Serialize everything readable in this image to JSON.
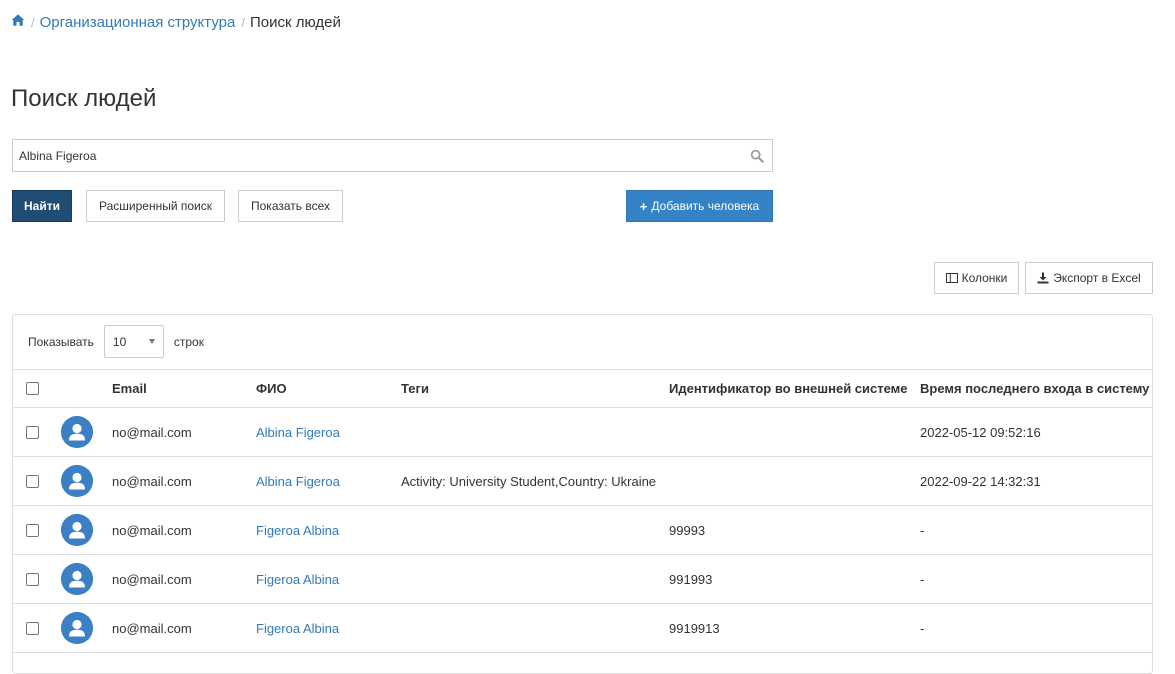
{
  "breadcrumb": {
    "items": [
      {
        "label": "Организационная структура"
      },
      {
        "label": "Поиск людей"
      }
    ]
  },
  "page": {
    "title": "Поиск людей"
  },
  "search": {
    "value": "Albina Figeroa",
    "placeholder": ""
  },
  "buttons": {
    "find": "Найти",
    "advanced": "Расширенный поиск",
    "show_all": "Показать всех",
    "add_person": "Добавить человека",
    "columns": "Колонки",
    "export": "Экспорт в Excel"
  },
  "table": {
    "length": {
      "prefix": "Показывать",
      "value": "10",
      "suffix": "строк"
    },
    "columns": {
      "email": "Email",
      "fio": "ФИО",
      "tags": "Теги",
      "external_id": "Идентификатор во внешней системе",
      "last_login": "Время последнего входа в систему"
    },
    "rows": [
      {
        "email": "no@mail.com",
        "fio": "Albina Figeroa",
        "tags": "",
        "external_id": "",
        "last_login": "2022-05-12 09:52:16"
      },
      {
        "email": "no@mail.com",
        "fio": "Albina Figeroa",
        "tags": "Activity: University Student,Country: Ukraine",
        "external_id": "",
        "last_login": "2022-09-22 14:32:31"
      },
      {
        "email": "no@mail.com",
        "fio": "Figeroa Albina",
        "tags": "",
        "external_id": "99993",
        "last_login": "-"
      },
      {
        "email": "no@mail.com",
        "fio": "Figeroa Albina",
        "tags": "",
        "external_id": "991993",
        "last_login": "-"
      },
      {
        "email": "no@mail.com",
        "fio": "Figeroa Albina",
        "tags": "",
        "external_id": "9919913",
        "last_login": "-"
      }
    ]
  },
  "icons": {
    "home": "home-icon",
    "search": "search-icon",
    "columns": "columns-icon",
    "export": "download-icon",
    "avatar": "user-avatar-icon"
  },
  "colors": {
    "primary": "#204d74",
    "info": "#3583c6",
    "link": "#337ab7",
    "avatar": "#3b7fc4"
  }
}
